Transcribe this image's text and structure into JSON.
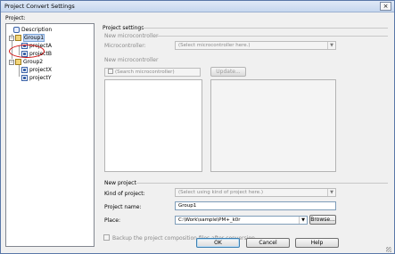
{
  "window": {
    "title": "Project Convert Settings",
    "close_glyph": "×"
  },
  "tree": {
    "label": "Project:",
    "items": [
      {
        "name": "Description"
      },
      {
        "name": "Group1"
      },
      {
        "name": "projectA"
      },
      {
        "name": "projectB"
      },
      {
        "name": "Group2"
      },
      {
        "name": "projectX"
      },
      {
        "name": "projectY"
      }
    ],
    "highlight_color": "#d01010"
  },
  "settings": {
    "header": "Project settings",
    "new_microcontroller": {
      "group_label": "New microcontroller",
      "microcontroller_label": "Microcontroller:",
      "microcontroller_placeholder": "(Select microcontroller here.)",
      "list_label": "New microcontroller",
      "search_placeholder": "(Search microcontroller)",
      "update_button": "Update..."
    },
    "new_project": {
      "group_label": "New project",
      "kind_label": "Kind of project:",
      "kind_placeholder": "(Select using kind of project here.)",
      "name_label": "Project name:",
      "name_value": "Group1",
      "place_label": "Place:",
      "place_value": "C:\\Work\\sample\\PM+_k0r",
      "browse_button": "Browse..."
    },
    "backup_checkbox_label": "Backup the project composition files after conversion"
  },
  "footer": {
    "ok": "OK",
    "cancel": "Cancel",
    "help": "Help"
  }
}
